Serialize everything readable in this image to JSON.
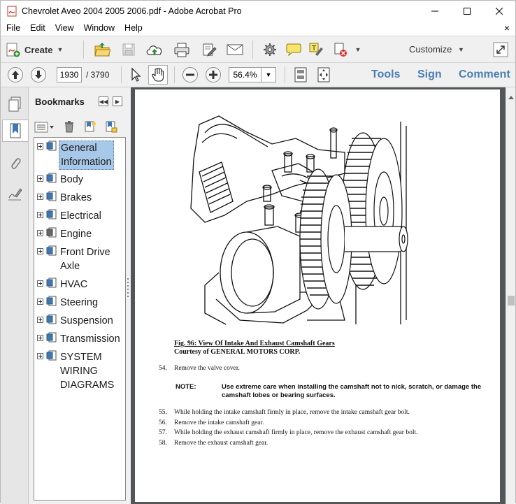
{
  "window": {
    "title": "Chevrolet Aveo 2004 2005 2006.pdf - Adobe Acrobat Pro"
  },
  "menubar": {
    "items": [
      "File",
      "Edit",
      "View",
      "Window",
      "Help"
    ],
    "close_doc": "×"
  },
  "toolbar": {
    "create_label": "Create",
    "customize_label": "Customize"
  },
  "navigation": {
    "current_page": "1930",
    "total_pages": "/ 3790",
    "zoom": "56.4%",
    "pane_links": [
      "Tools",
      "Sign",
      "Comment"
    ]
  },
  "bookmarks": {
    "title": "Bookmarks",
    "items": [
      {
        "label_lines": [
          "General",
          "Information"
        ],
        "selected": true
      },
      {
        "label_lines": [
          "Body"
        ]
      },
      {
        "label_lines": [
          "Brakes"
        ]
      },
      {
        "label_lines": [
          "Electrical"
        ]
      },
      {
        "label_lines": [
          "Engine"
        ]
      },
      {
        "label_lines": [
          "Front Drive",
          "Axle"
        ]
      },
      {
        "label_lines": [
          "HVAC"
        ]
      },
      {
        "label_lines": [
          "Steering"
        ]
      },
      {
        "label_lines": [
          "Suspension"
        ]
      },
      {
        "label_lines": [
          "Transmission"
        ]
      },
      {
        "label_lines": [
          "SYSTEM",
          "WIRING",
          "DIAGRAMS"
        ]
      }
    ]
  },
  "document": {
    "figure_caption": "Fig. 96: View Of Intake And Exhaust Camshaft Gears",
    "figure_courtesy": "Courtesy of GENERAL MOTORS CORP.",
    "steps": [
      {
        "num": "54.",
        "text": "Remove the valve cover."
      },
      {
        "num": "55.",
        "text": "While holding the intake camshaft firmly in place, remove the intake camshaft gear bolt."
      },
      {
        "num": "56.",
        "text": "Remove the intake camshaft gear."
      },
      {
        "num": "57.",
        "text": "While holding the exhaust camshaft firmly in place, remove the exhaust camshaft gear bolt."
      },
      {
        "num": "58.",
        "text": "Remove the exhaust camshaft gear."
      }
    ],
    "note_label": "NOTE:",
    "note_text": "Use extreme care when installing the camshaft not to nick, scratch, or damage the camshaft lobes or bearing surfaces."
  },
  "colors": {
    "pane_link": "#4a7fb4",
    "selected_bookmark": "#a7c8e8",
    "doc_background": "#525659"
  }
}
